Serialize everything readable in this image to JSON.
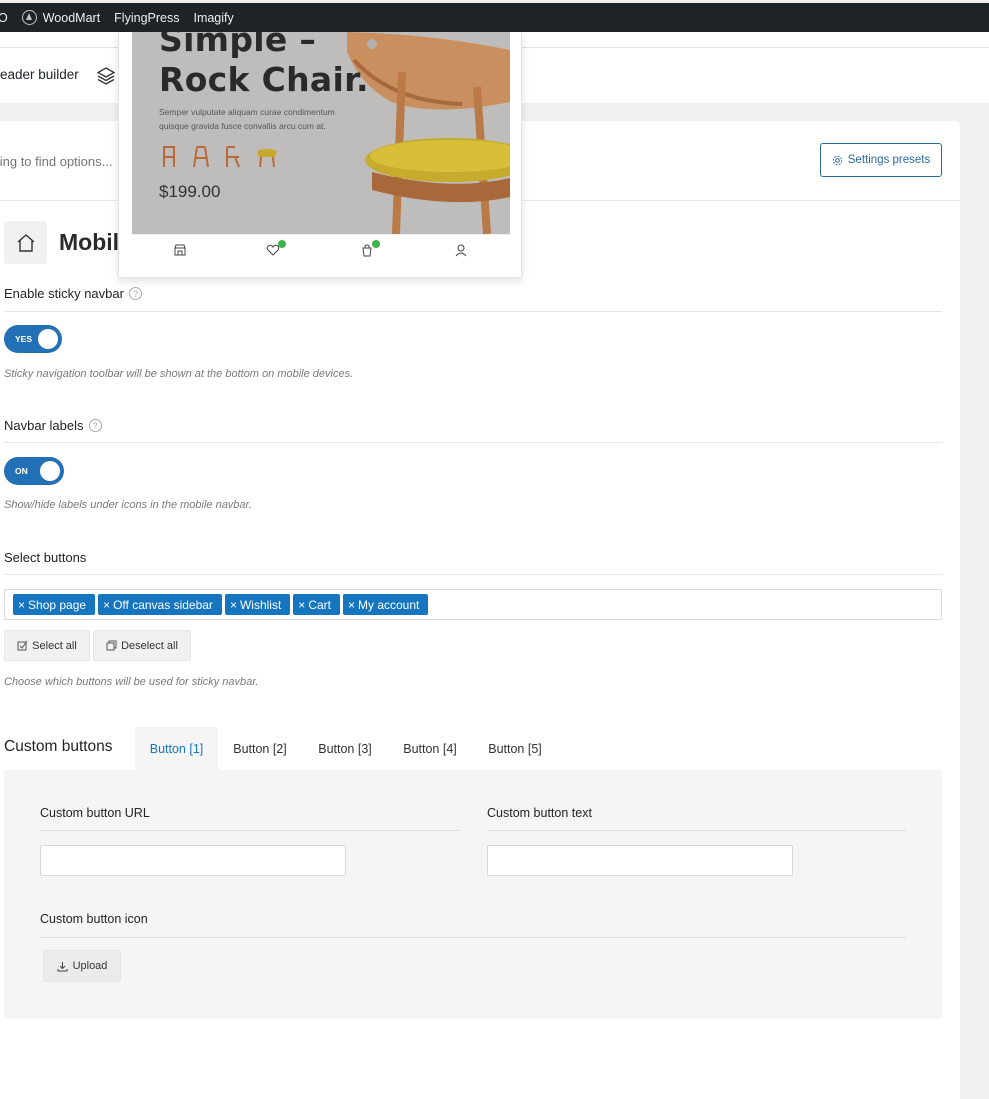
{
  "adminbar": {
    "fragment": "O",
    "items": [
      "WoodMart",
      "FlyingPress",
      "Imagify"
    ]
  },
  "subheader": {
    "header_builder_label": "eader builder",
    "layers_icon": "layers-icon"
  },
  "search": {
    "placeholder": "yping to find options..."
  },
  "presets": {
    "label": "Settings presets",
    "icon": "gear-icon"
  },
  "section": {
    "title": "Mobile",
    "icon": "home-icon"
  },
  "preview": {
    "title": "Simple –\nRock Chair.",
    "description": "Semper vulputate aliquam curae condimentum quisque gravida fusce convallis arcu cum at.",
    "price": "$199.00",
    "nav_icons": [
      "shop-icon",
      "heart-icon",
      "cart-icon",
      "user-icon"
    ]
  },
  "sticky_navbar": {
    "label": "Enable sticky navbar",
    "toggle": "YES",
    "hint": "Sticky navigation toolbar will be shown at the bottom on mobile devices."
  },
  "navbar_labels": {
    "label": "Navbar labels",
    "toggle": "ON",
    "hint": "Show/hide labels under icons in the mobile navbar."
  },
  "select_buttons": {
    "label": "Select buttons",
    "chips": [
      "Shop page",
      "Off canvas sidebar",
      "Wishlist",
      "Cart",
      "My account"
    ],
    "chip_remove": "×",
    "select_all": "Select all",
    "deselect_all": "Deselect all",
    "hint": "Choose which buttons will be used for sticky navbar."
  },
  "custom_buttons": {
    "title": "Custom buttons",
    "tabs": [
      "Button [1]",
      "Button [2]",
      "Button [3]",
      "Button [4]",
      "Button [5]"
    ],
    "active_tab": 0,
    "url_label": "Custom button URL",
    "url_value": "",
    "text_label": "Custom button text",
    "text_value": "",
    "icon_label": "Custom button icon",
    "upload_label": "Upload"
  },
  "colors": {
    "accent": "#1575bf",
    "toggle": "#2270b5",
    "adminbar": "#1d2327",
    "badge": "#3bb54a"
  }
}
